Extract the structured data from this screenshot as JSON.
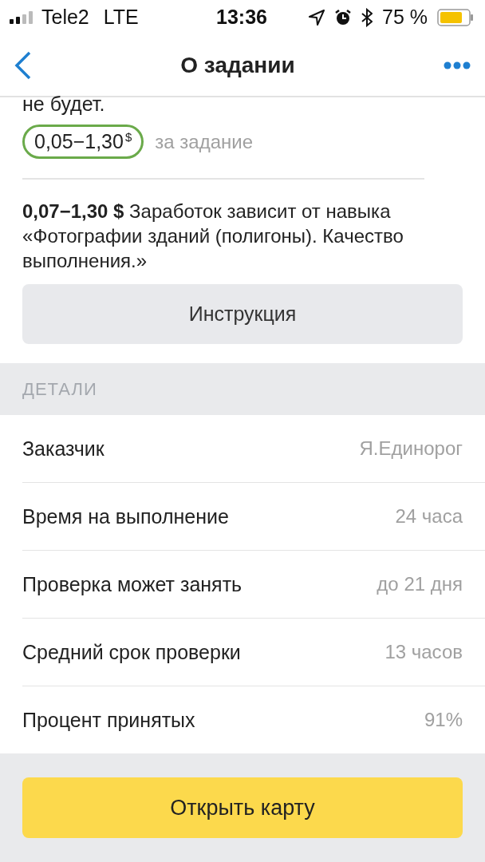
{
  "status_bar": {
    "carrier": "Tele2",
    "network": "LTE",
    "time": "13:36",
    "battery": "75 %"
  },
  "nav": {
    "title": "О задании"
  },
  "intro_tail": "не будет.",
  "price": {
    "value": "0,05−1,30",
    "currency": "$",
    "note": "за задание"
  },
  "earnings": "**0,07−1,30 $** Заработок зависит от навыка «Фотографии зданий (полигоны). Качество выполнения.»",
  "instruction_button": "Инструкция",
  "details": {
    "header": "ДЕТАЛИ",
    "rows": [
      {
        "label": "Заказчик",
        "value": "Я.Единорог"
      },
      {
        "label": "Время на выполнение",
        "value": "24 часа"
      },
      {
        "label": "Проверка может занять",
        "value": "до 21 дня"
      },
      {
        "label": "Средний срок проверки",
        "value": "13 часов"
      },
      {
        "label": "Процент принятых",
        "value": "91%"
      }
    ]
  },
  "open_map_button": "Открыть карту"
}
